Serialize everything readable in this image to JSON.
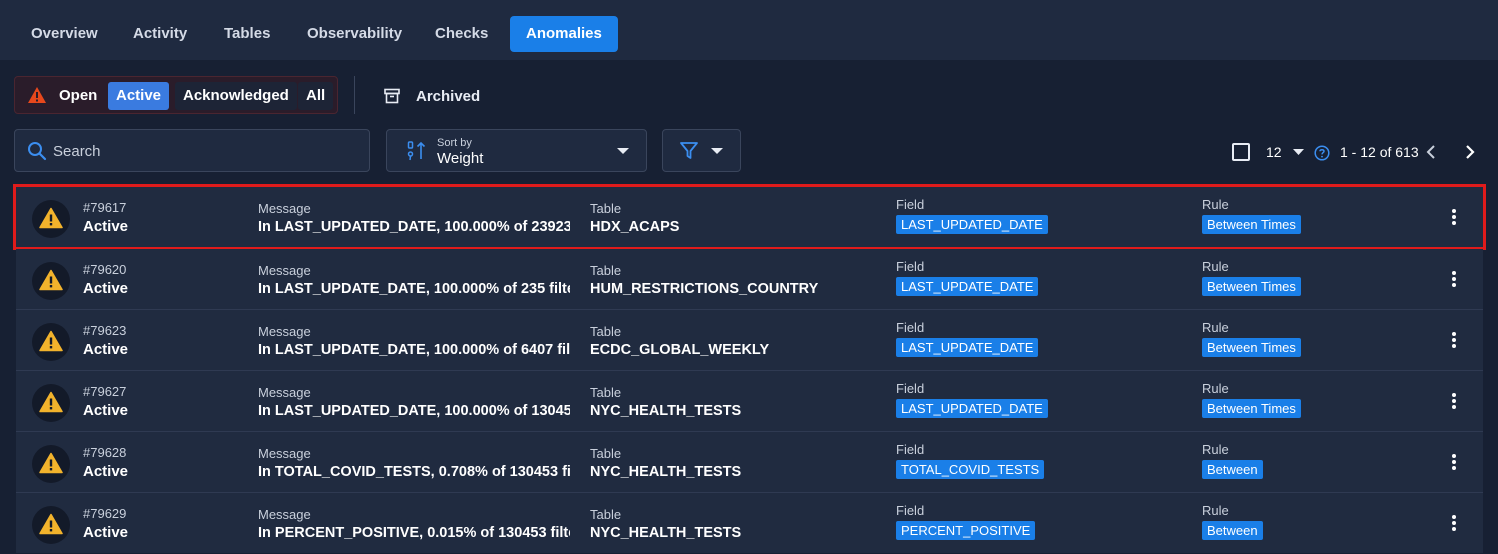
{
  "tabs": [
    {
      "label": "Overview",
      "active": false
    },
    {
      "label": "Activity",
      "active": false
    },
    {
      "label": "Tables",
      "active": false
    },
    {
      "label": "Observability",
      "active": false
    },
    {
      "label": "Checks",
      "active": false
    },
    {
      "label": "Anomalies",
      "active": true
    }
  ],
  "status_filter": {
    "open_label": "Open",
    "active_label": "Active",
    "acknowledged_label": "Acknowledged",
    "all_label": "All",
    "selected": "Active"
  },
  "archived_label": "Archived",
  "search": {
    "placeholder": "Search",
    "value": ""
  },
  "sort": {
    "caption": "Sort by",
    "value": "Weight"
  },
  "pagination": {
    "page_size": "12",
    "range": "1 - 12 of 613"
  },
  "colors": {
    "accent": "#1a7fe8",
    "warning": "#f2b32c",
    "highlight": "#e01b1b"
  },
  "labels": {
    "message": "Message",
    "table": "Table",
    "field": "Field",
    "rule": "Rule"
  },
  "rows": [
    {
      "id": "#79617",
      "status": "Active",
      "message": "In LAST_UPDATED_DATE, 100.000% of 23923 ...",
      "table": "HDX_ACAPS",
      "field": "LAST_UPDATED_DATE",
      "rule": "Between Times",
      "highlighted": true
    },
    {
      "id": "#79620",
      "status": "Active",
      "message": "In LAST_UPDATE_DATE, 100.000% of 235 filte...",
      "table": "HUM_RESTRICTIONS_COUNTRY",
      "field": "LAST_UPDATE_DATE",
      "rule": "Between Times",
      "highlighted": false
    },
    {
      "id": "#79623",
      "status": "Active",
      "message": "In LAST_UPDATE_DATE, 100.000% of 6407 fil...",
      "table": "ECDC_GLOBAL_WEEKLY",
      "field": "LAST_UPDATE_DATE",
      "rule": "Between Times",
      "highlighted": false
    },
    {
      "id": "#79627",
      "status": "Active",
      "message": "In LAST_UPDATED_DATE, 100.000% of 13045...",
      "table": "NYC_HEALTH_TESTS",
      "field": "LAST_UPDATED_DATE",
      "rule": "Between Times",
      "highlighted": false
    },
    {
      "id": "#79628",
      "status": "Active",
      "message": "In TOTAL_COVID_TESTS, 0.708% of 130453 fil...",
      "table": "NYC_HEALTH_TESTS",
      "field": "TOTAL_COVID_TESTS",
      "rule": "Between",
      "highlighted": false
    },
    {
      "id": "#79629",
      "status": "Active",
      "message": "In PERCENT_POSITIVE, 0.015% of 130453 filte...",
      "table": "NYC_HEALTH_TESTS",
      "field": "PERCENT_POSITIVE",
      "rule": "Between",
      "highlighted": false
    }
  ]
}
